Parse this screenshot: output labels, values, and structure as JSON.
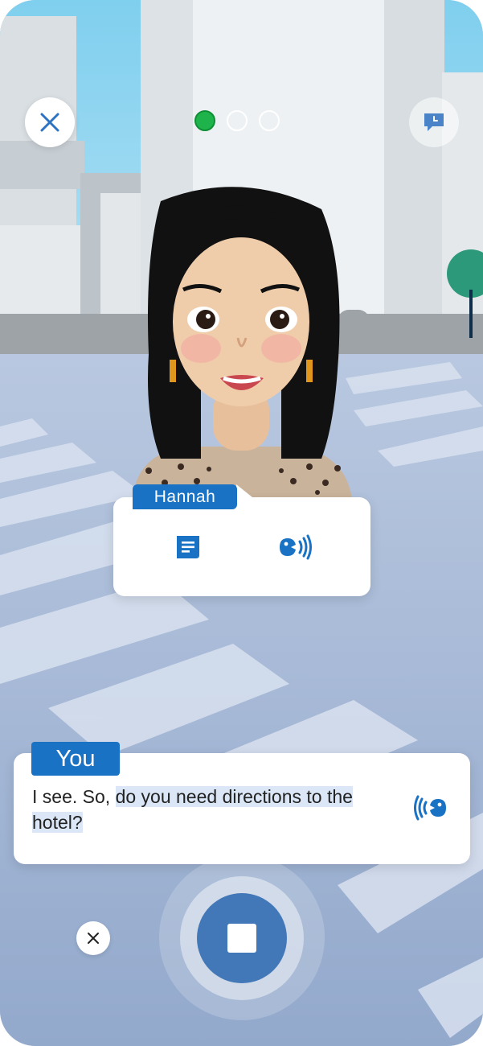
{
  "progress": {
    "total": 3,
    "current": 1
  },
  "colors": {
    "accent": "#1a72c4",
    "active_dot": "#1fb44b",
    "mic": "#4378b8"
  },
  "icons": {
    "close_top": "close-icon",
    "history": "chat-history-icon",
    "text": "text-bubble-icon",
    "audio": "speaker-icon",
    "cancel": "close-icon",
    "stop": "stop-icon"
  },
  "hannah": {
    "name": "Hannah"
  },
  "you": {
    "label": "You",
    "text_plain": "I see. So, ",
    "text_highlight_1": "do you need directions to the",
    "text_highlight_2": "hotel?"
  }
}
